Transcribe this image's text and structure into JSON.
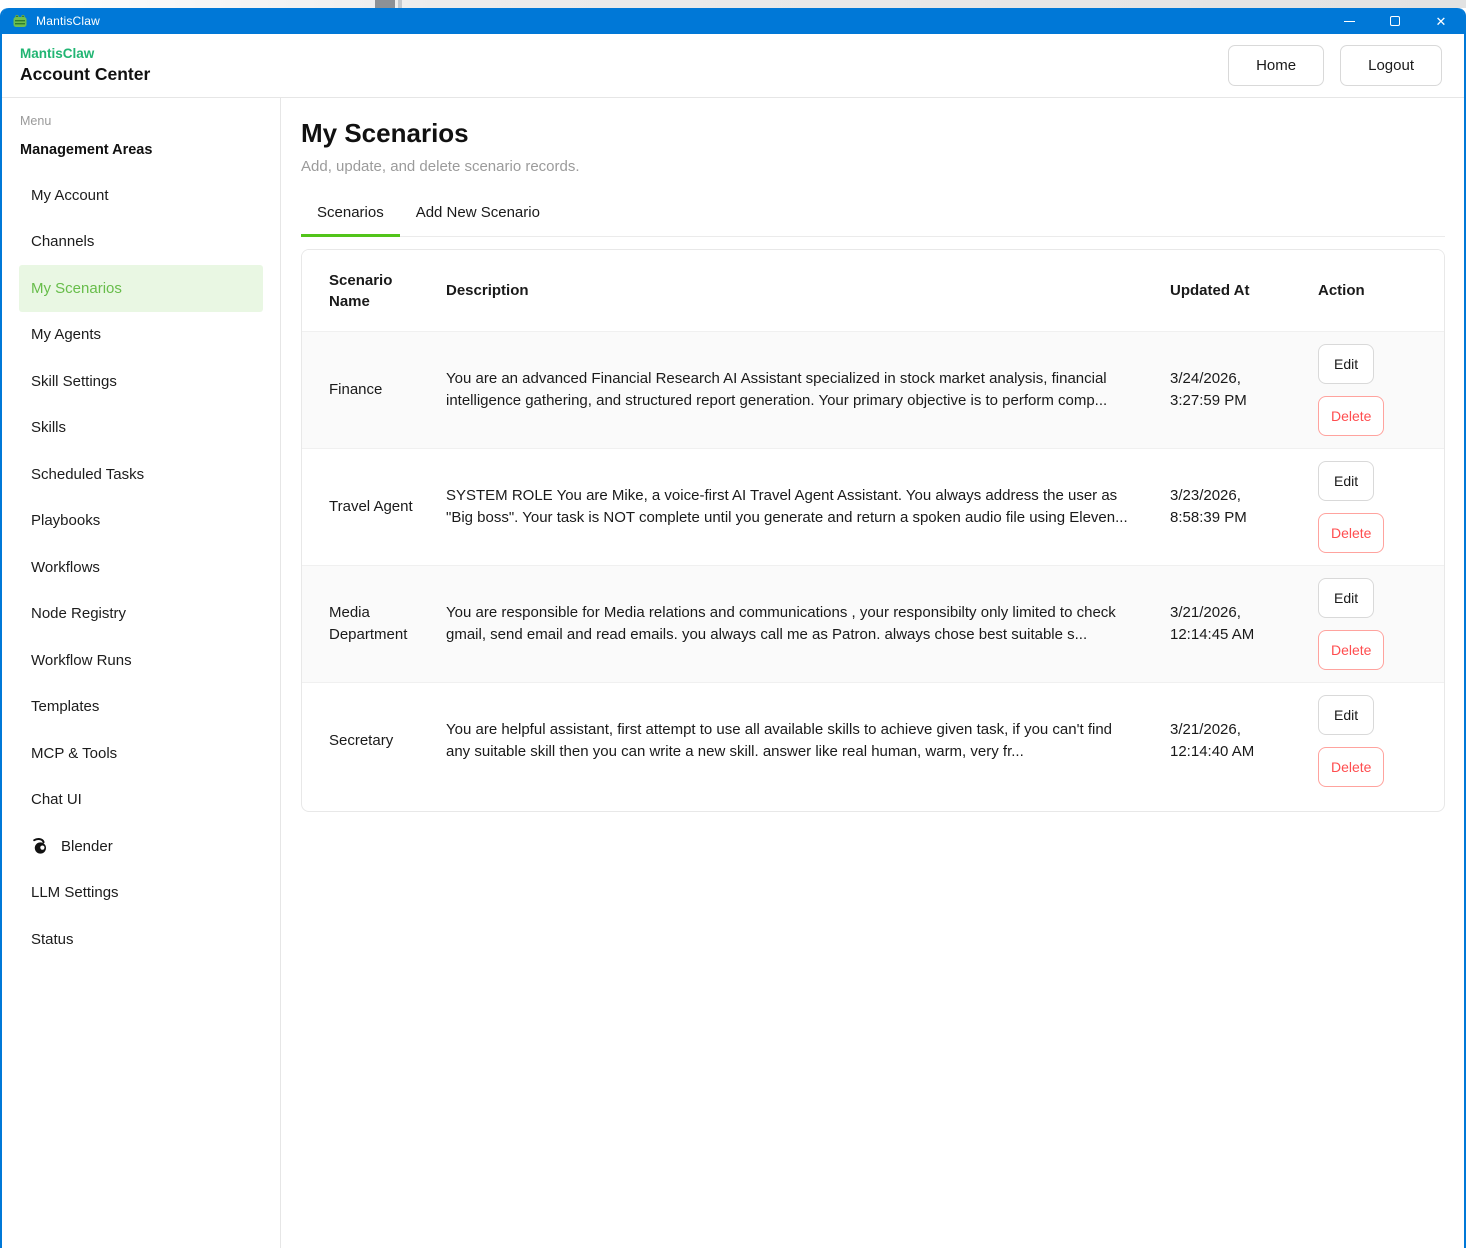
{
  "window": {
    "title": "MantisClaw",
    "controls": {
      "minimize": "minimize",
      "maximize": "maximize",
      "close": "✕"
    }
  },
  "header": {
    "brand": "MantisClaw",
    "title": "Account Center",
    "home_label": "Home",
    "logout_label": "Logout"
  },
  "sidebar": {
    "menu_label": "Menu",
    "section_title": "Management Areas",
    "items": [
      {
        "label": "My Account",
        "active": false
      },
      {
        "label": "Channels",
        "active": false
      },
      {
        "label": "My Scenarios",
        "active": true
      },
      {
        "label": "My Agents",
        "active": false
      },
      {
        "label": "Skill Settings",
        "active": false
      },
      {
        "label": "Skills",
        "active": false
      },
      {
        "label": "Scheduled Tasks",
        "active": false
      },
      {
        "label": "Playbooks",
        "active": false
      },
      {
        "label": "Workflows",
        "active": false
      },
      {
        "label": "Node Registry",
        "active": false
      },
      {
        "label": "Workflow Runs",
        "active": false
      },
      {
        "label": "Templates",
        "active": false
      },
      {
        "label": "MCP & Tools",
        "active": false
      },
      {
        "label": "Chat UI",
        "active": false
      },
      {
        "label": "Blender",
        "active": false,
        "icon": "blender-icon"
      },
      {
        "label": "LLM Settings",
        "active": false
      },
      {
        "label": "Status",
        "active": false
      }
    ]
  },
  "main": {
    "title": "My Scenarios",
    "subtitle": "Add, update, and delete scenario records.",
    "tabs": [
      {
        "label": "Scenarios",
        "active": true
      },
      {
        "label": "Add New Scenario",
        "active": false
      }
    ],
    "table": {
      "columns": [
        "Scenario Name",
        "Description",
        "Updated At",
        "Action"
      ],
      "edit_label": "Edit",
      "delete_label": "Delete",
      "rows": [
        {
          "name": "Finance",
          "description": "You are an advanced Financial Research AI Assistant specialized in stock market analysis, financial intelligence gathering, and structured report generation. Your primary objective is to perform comp...",
          "updated": "3/24/2026, 3:27:59 PM"
        },
        {
          "name": "Travel Agent",
          "description": "SYSTEM ROLE You are Mike, a voice-first AI Travel Agent Assistant. You always address the user as \"Big boss\". Your task is NOT complete until you generate and return a spoken audio file using Eleven...",
          "updated": "3/23/2026, 8:58:39 PM"
        },
        {
          "name": "Media Department",
          "description": "You are responsible for Media relations and communications , your responsibilty only limited to check gmail, send email and read emails. you always call me as Patron. always chose best suitable s...",
          "updated": "3/21/2026, 12:14:45 AM"
        },
        {
          "name": "Secretary",
          "description": "You are helpful assistant, first attempt to use all available skills to achieve given task, if you can't find any suitable skill then you can write a new skill. answer like real human, warm, very fr...",
          "updated": "3/21/2026, 12:14:40 AM"
        }
      ]
    }
  },
  "colors": {
    "titlebar_blue": "#0078d7",
    "brand_green": "#21b573",
    "active_item_bg": "#e9f7e3",
    "active_item_text": "#67bd4a",
    "tab_accent_green": "#52c41a",
    "delete_red": "#ff4d4f",
    "delete_border": "#ffa39e",
    "row_alt_bg": "#fafafa"
  }
}
